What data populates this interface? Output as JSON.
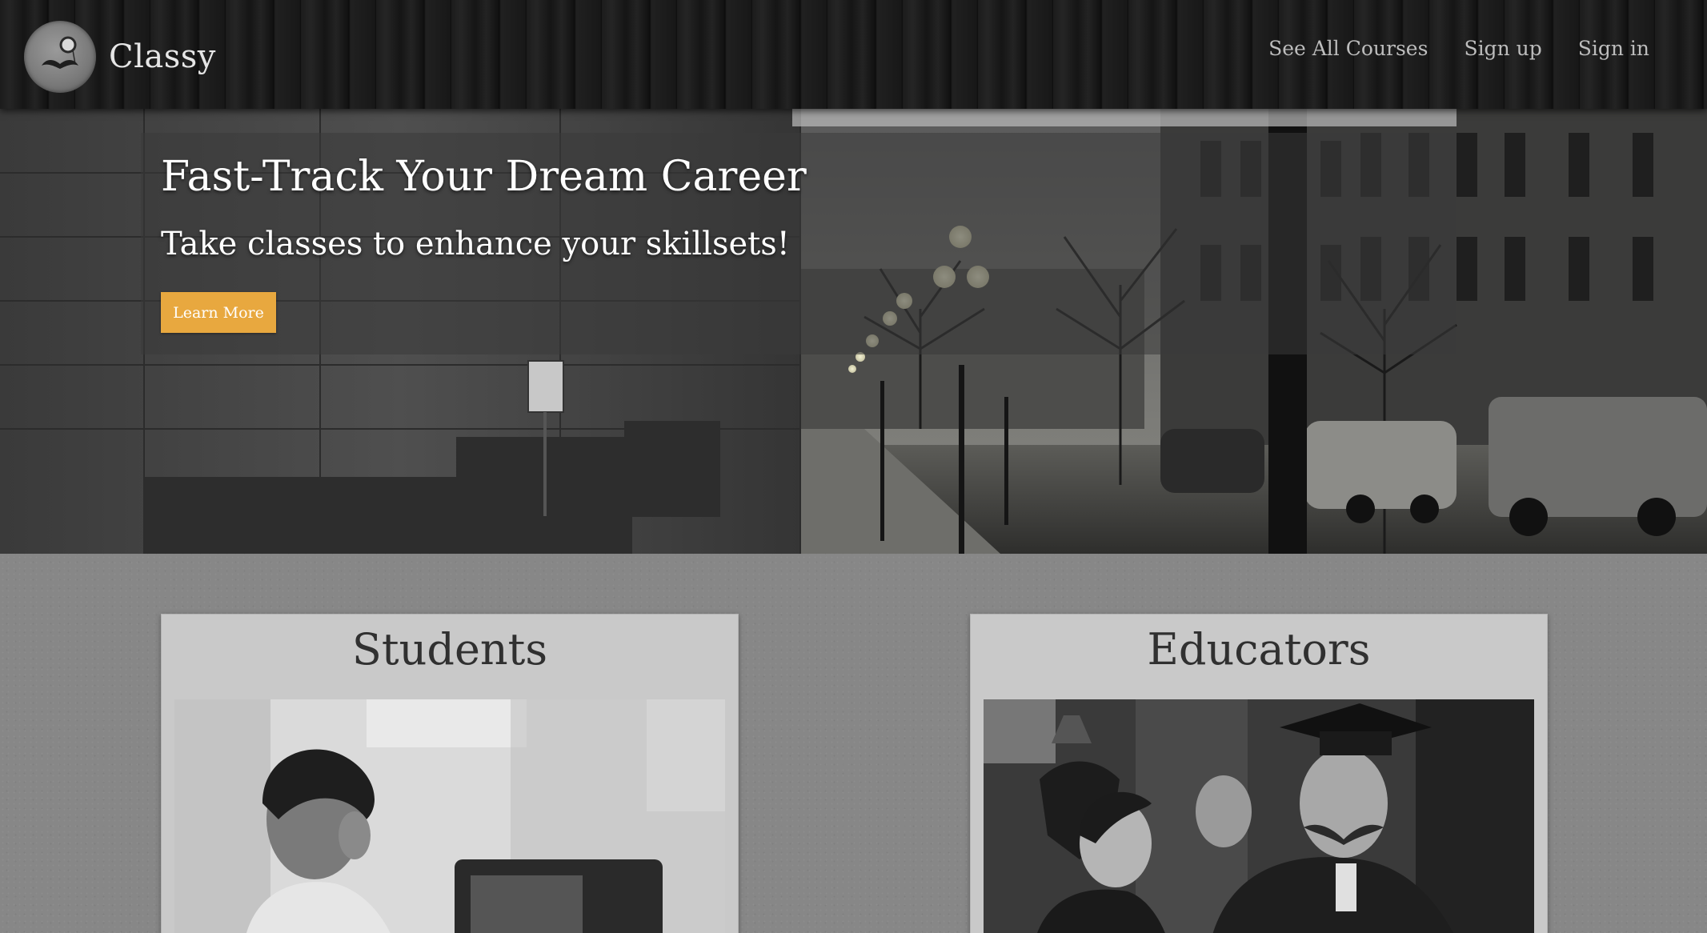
{
  "navbar": {
    "brand": "Classy",
    "logo_icon": "monocle-mustache-icon",
    "links": [
      "See All Courses",
      "Sign up",
      "Sign in"
    ]
  },
  "hero": {
    "title": "Fast-Track Your Dream Career",
    "subtitle": "Take classes to enhance your skillsets!",
    "cta_label": "Learn More",
    "cta_color": "#e8a83f"
  },
  "cards": [
    {
      "title": "Students"
    },
    {
      "title": "Educators"
    }
  ]
}
